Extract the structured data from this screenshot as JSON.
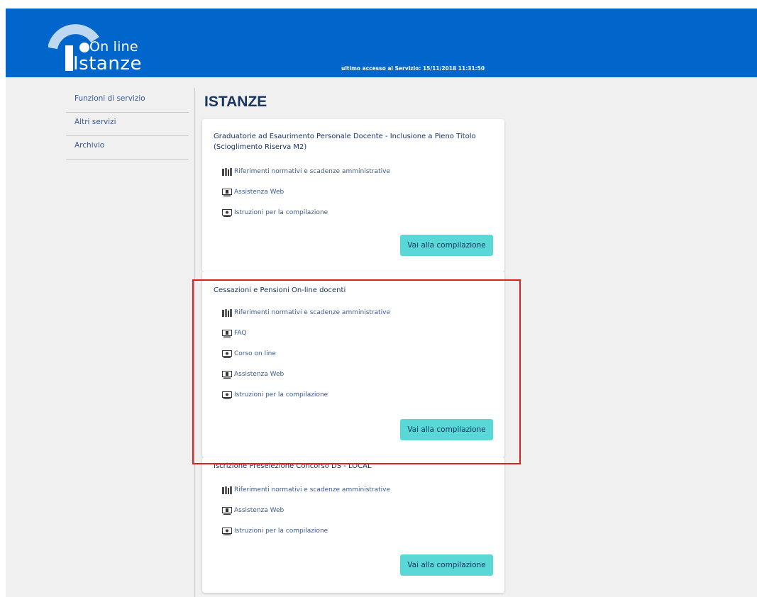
{
  "header": {
    "logo_online": "On line",
    "logo_stanze": "Istanze",
    "last_access": "ultimo accesso al Servizio:  15/11/2018 11:31:50"
  },
  "sidebar": {
    "items": [
      {
        "label": "Funzioni di servizio"
      },
      {
        "label": "Altri servizi"
      },
      {
        "label": "Archivio"
      }
    ]
  },
  "page_title": "ISTANZE",
  "cards": [
    {
      "title": "Graduatorie ad Esaurimento Personale Docente - Inclusione a Pieno Titolo (Scioglimento Riserva M2)",
      "links": [
        {
          "label": "Riferimenti normativi e scadenze amministrative",
          "icon": "books-icon"
        },
        {
          "label": "Assistenza Web",
          "icon": "monitor-icon"
        },
        {
          "label": "Istruzioni per la compilazione",
          "icon": "screen-icon"
        }
      ],
      "button": "Vai alla compilazione"
    },
    {
      "title": "Cessazioni e Pensioni On-line docenti",
      "links": [
        {
          "label": "Riferimenti normativi e scadenze amministrative",
          "icon": "books-icon"
        },
        {
          "label": "FAQ",
          "icon": "monitor-icon"
        },
        {
          "label": "Corso on line",
          "icon": "screen-icon"
        },
        {
          "label": "Assistenza Web",
          "icon": "monitor-icon"
        },
        {
          "label": "Istruzioni per la compilazione",
          "icon": "screen-icon"
        }
      ],
      "button": "Vai alla compilazione"
    },
    {
      "title": "Iscrizione Preselezione Concorso DS - LOCAL",
      "links": [
        {
          "label": "Riferimenti normativi e scadenze amministrative",
          "icon": "books-icon"
        },
        {
          "label": "Assistenza Web",
          "icon": "monitor-icon"
        },
        {
          "label": "Istruzioni per la compilazione",
          "icon": "screen-icon"
        }
      ],
      "button": "Vai alla compilazione"
    }
  ],
  "colors": {
    "header_blue": "#0066cc",
    "button_teal": "#5ad8d8",
    "highlight_red": "#e02020"
  }
}
